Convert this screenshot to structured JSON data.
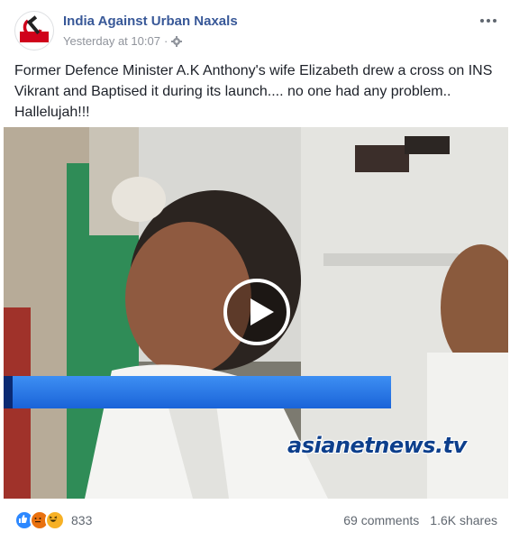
{
  "post": {
    "page_name": "India Against Urban Naxals",
    "timestamp": "Yesterday at 10:07",
    "separator": "·",
    "privacy_icon": "gear-icon",
    "text": "Former Defence Minister A.K Anthony's wife Elizabeth drew a cross on INS Vikrant and Baptised it during its launch.... no one had any problem.. Hallelujah!!!"
  },
  "video": {
    "watermark": "asianetnews.tv",
    "play_icon": "play-icon"
  },
  "footer": {
    "reaction_icons": [
      "like-icon",
      "angry-icon",
      "haha-icon"
    ],
    "reaction_count": "833",
    "comments": "69 comments",
    "shares": "1.6K shares"
  },
  "colors": {
    "page_name": "#385898",
    "meta_text": "#90949c",
    "broadcast_band": "#2a78ea",
    "brand": "#0d3f8c"
  }
}
